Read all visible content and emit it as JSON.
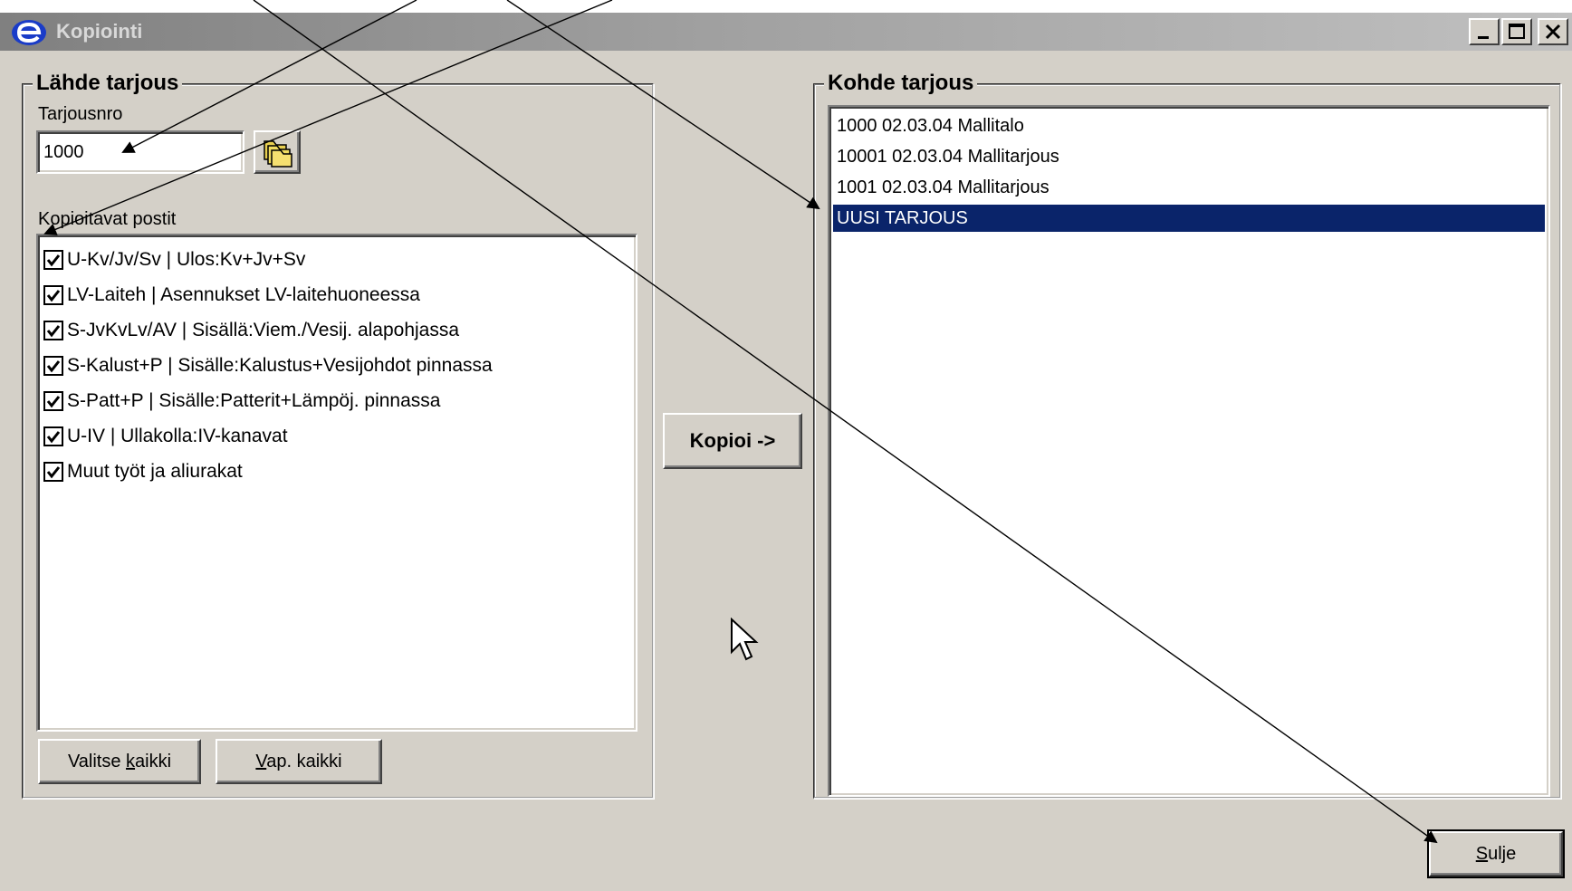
{
  "window": {
    "title": "Kopiointi"
  },
  "source": {
    "group_title": "Lähde tarjous",
    "offer_number_label": "Tarjousnro",
    "offer_number_value": "1000",
    "items_label": "Kopioitavat postit",
    "items": [
      {
        "label": "U-Kv/Jv/Sv | Ulos:Kv+Jv+Sv",
        "checked": true
      },
      {
        "label": "LV-Laiteh | Asennukset LV-laitehuoneessa",
        "checked": true
      },
      {
        "label": "S-JvKvLv/AV | Sisällä:Viem./Vesij. alapohjassa",
        "checked": true
      },
      {
        "label": "S-Kalust+P | Sisälle:Kalustus+Vesijohdot pinnassa",
        "checked": true
      },
      {
        "label": "S-Patt+P | Sisälle:Patterit+Lämpöj. pinnassa",
        "checked": true
      },
      {
        "label": "U-IV |  Ullakolla:IV-kanavat",
        "checked": true
      },
      {
        "label": "Muut työt ja aliurakat",
        "checked": true
      }
    ],
    "select_all": {
      "pre": "Valitse ",
      "accel": "k",
      "post": "aikki"
    },
    "deselect_all": {
      "pre": "",
      "accel": "V",
      "post": "ap. kaikki"
    }
  },
  "copy_button": "Kopioi ->",
  "target": {
    "group_title": "Kohde tarjous",
    "items": [
      {
        "label": "1000 02.03.04 Mallitalo",
        "selected": false
      },
      {
        "label": "10001 02.03.04 Mallitarjous",
        "selected": false
      },
      {
        "label": "1001 02.03.04 Mallitarjous",
        "selected": false
      },
      {
        "label": "UUSI TARJOUS",
        "selected": true
      }
    ]
  },
  "close_button": {
    "pre": "",
    "accel": "S",
    "post": "ulje"
  },
  "colors": {
    "dialog_bg": "#d4d0c8",
    "selection": "#0a246a",
    "title_gradient_start": "#808080",
    "app_icon": "#1a3cc8"
  }
}
